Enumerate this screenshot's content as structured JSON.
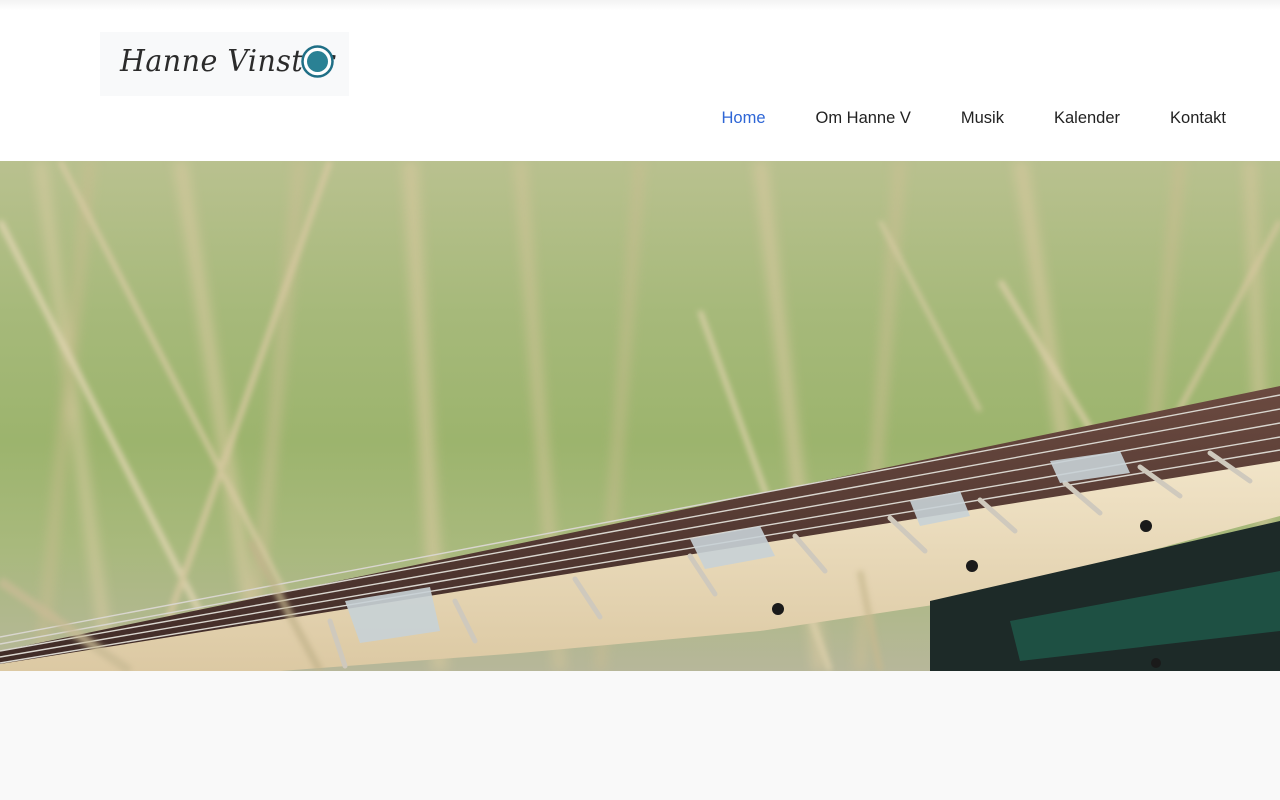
{
  "site": {
    "logo_text": "Hanne Vinster",
    "logo_alt": "Hanne Vinster logo"
  },
  "nav": {
    "items": [
      {
        "label": "Home",
        "active": true
      },
      {
        "label": "Om Hanne V",
        "active": false
      },
      {
        "label": "Musik",
        "active": false
      },
      {
        "label": "Kalender",
        "active": false
      },
      {
        "label": "Kontakt",
        "active": false
      }
    ]
  },
  "hero": {
    "image_alt": "Guitar neck lying in tall grass"
  },
  "colors": {
    "nav_active": "#2e66d6",
    "nav_text": "#222222",
    "logo_ring": "#1f6f86"
  }
}
